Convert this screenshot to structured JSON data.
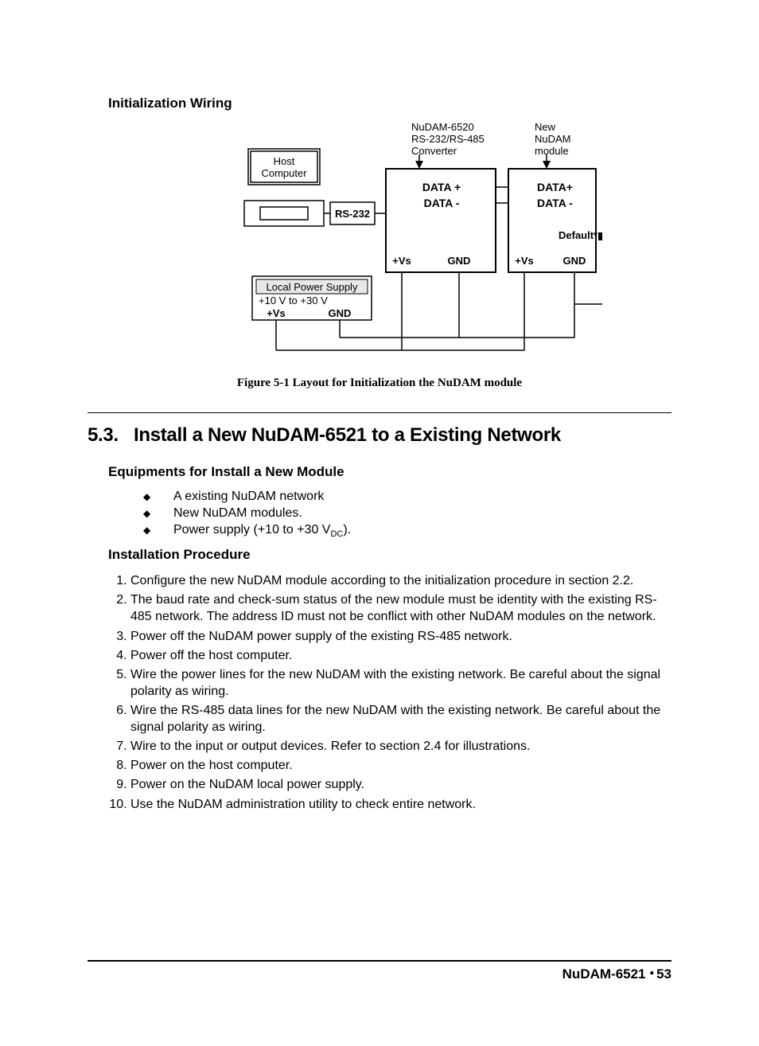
{
  "heading_init_wiring": "Initialization Wiring",
  "figure": {
    "caption": "Figure 5-1  Layout for Initialization the NuDAM module",
    "host_computer": "Host\nComputer",
    "converter_label": "NuDAM-6520\nRS-232/RS-485\nConverter",
    "new_module_label": "New\nNuDAM\nmodule",
    "rs232": "RS-232",
    "data_plus": "DATA +",
    "data_minus": "DATA -",
    "data_plus2": "DATA+",
    "data_minus2": "DATA -",
    "default": "Default*",
    "plus_vs": "+Vs",
    "gnd": "GND",
    "power_supply_title": "Local Power Supply",
    "power_supply_range": "+10 V to +30 V"
  },
  "section_number": "5.3.",
  "section_title": "Install a New NuDAM-6521 to a Existing Network",
  "equipments_heading": "Equipments for Install a New Module",
  "equipments": [
    "A existing NuDAM network",
    "New NuDAM modules.",
    "Power supply (+10  to +30 V"
  ],
  "vdc_suffix": "DC",
  "after_vdc": ").",
  "procedure_heading": "Installation Procedure",
  "procedure": [
    "Configure the new NuDAM module according to the initialization procedure in section 2.2.",
    "The baud rate and check-sum status of the new module must be identity with the existing RS-485 network.  The address ID must not be conflict with other NuDAM modules on the network.",
    "Power off the NuDAM power supply of the existing RS-485 network.",
    "Power off the host computer.",
    "Wire the power lines for the new NuDAM with the existing network.  Be careful about the signal polarity as wiring.",
    "Wire the RS-485 data lines for the new NuDAM with the existing network.  Be careful about the signal polarity as wiring.",
    "Wire to the input or output devices.  Refer to section 2.4 for illustrations.",
    "Power on the host computer.",
    "Power on the NuDAM local power supply.",
    "Use the NuDAM administration utility to check entire network."
  ],
  "footer_product": "NuDAM-6521",
  "footer_page": "53"
}
